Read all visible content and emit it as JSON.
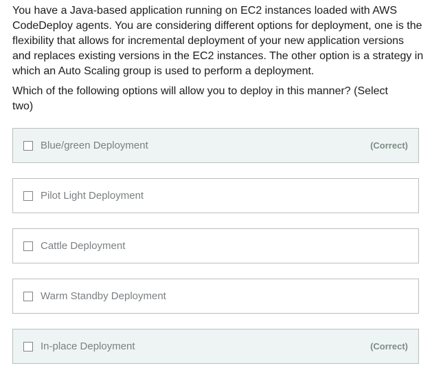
{
  "question": {
    "text": "You have a Java-based application running on EC2 instances loaded with AWS CodeDeploy agents. You are considering different options for deployment, one is the flexibility that allows for incremental deployment of your new application versions and replaces existing versions in the EC2 instances. The other option is a strategy in which an Auto Scaling group is used to perform a deployment.",
    "prompt": "Which of the following options will allow you to deploy in this manner? (Select two)"
  },
  "options": [
    {
      "label": "Blue/green Deployment",
      "correct": true,
      "tag": "(Correct)"
    },
    {
      "label": "Pilot Light Deployment",
      "correct": false,
      "tag": ""
    },
    {
      "label": "Cattle Deployment",
      "correct": false,
      "tag": ""
    },
    {
      "label": "Warm Standby Deployment",
      "correct": false,
      "tag": ""
    },
    {
      "label": "In-place Deployment",
      "correct": true,
      "tag": "(Correct)"
    }
  ],
  "colors": {
    "correct_background": "#eef4f3",
    "border": "#b9bec1",
    "option_text": "#7b7f82",
    "correct_tag": "#7d8c84"
  }
}
